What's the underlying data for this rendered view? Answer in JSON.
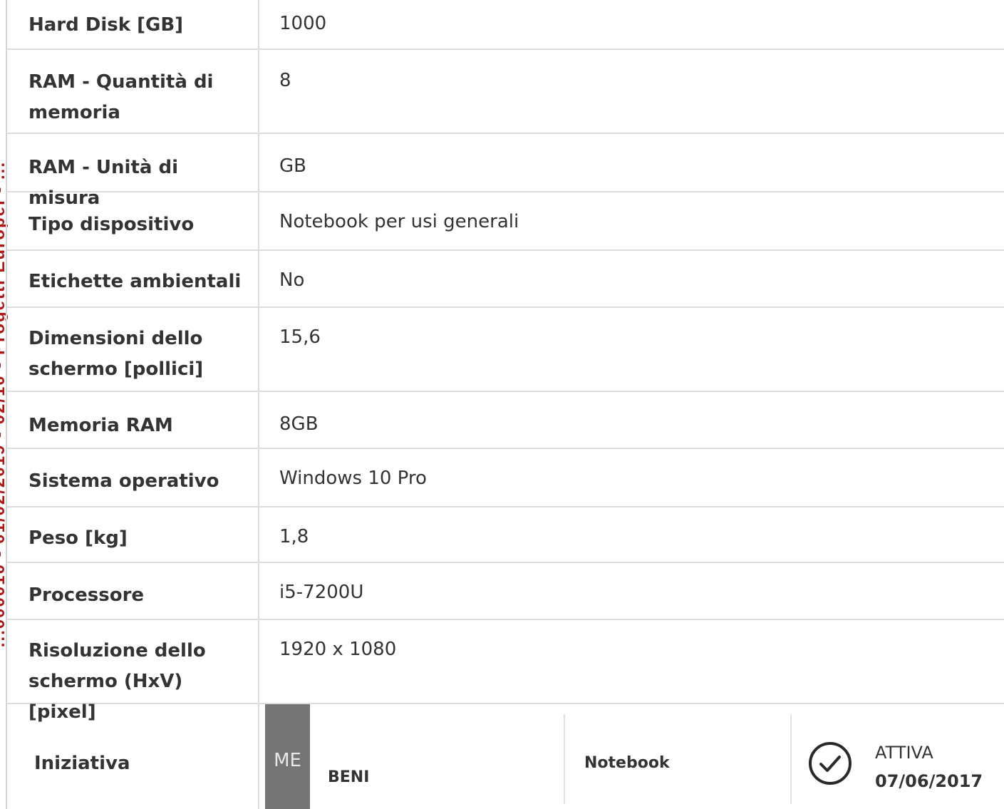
{
  "stamp": "...000010 - 01/02/2019 - 02/10 - Progetti Europei - ...",
  "spec_rows": [
    {
      "label": "Hard Disk [GB]",
      "value": "1000"
    },
    {
      "label": "RAM - Quantità di memoria",
      "value": "8"
    },
    {
      "label": "RAM - Unità di misura",
      "value": "GB"
    },
    {
      "label": "Tipo dispositivo",
      "value": "Notebook per usi generali"
    },
    {
      "label": "Etichette ambientali",
      "value": "No"
    },
    {
      "label": "Dimensioni dello schermo [pollici]",
      "value": "15,6"
    },
    {
      "label": "Memoria RAM",
      "value": "8GB"
    },
    {
      "label": "Sistema operativo",
      "value": "Windows 10 Pro"
    },
    {
      "label": "Peso [kg]",
      "value": "1,8"
    },
    {
      "label": "Processore",
      "value": "i5-7200U"
    },
    {
      "label": "Risoluzione dello schermo (HxV) [pixel]",
      "value": "1920 x 1080"
    }
  ],
  "iniziativa": {
    "label": "Iniziativa",
    "badge": "ME",
    "category": "BENI",
    "product": "Notebook",
    "status": "ATTIVA",
    "date": "07/06/2017",
    "icon": "check-circle-icon"
  }
}
